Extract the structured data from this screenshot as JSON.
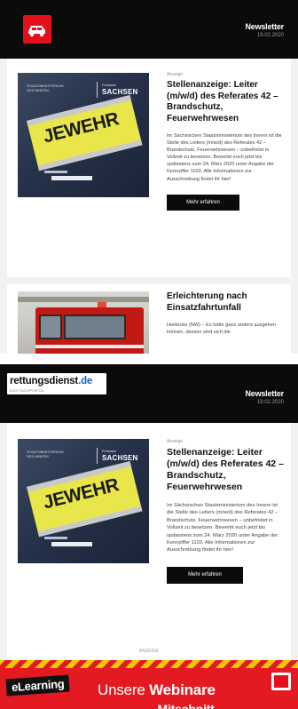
{
  "colors": {
    "header_bg": "#0b0b0b",
    "brand_red": "#e3101b",
    "button_bg": "#0b0b0b",
    "banner_red": "#e31a22",
    "link_blue": "#1f5fb0"
  },
  "view1": {
    "header": {
      "logo_icon": "red-car-logo-icon",
      "title": "Newsletter",
      "date": "19.02.2020"
    },
    "article1": {
      "kicker": "Anzeige",
      "title": "Stellenanzeige: Leiter (m/w/d) des Referates 42 – Brandschutz, Feuerwehrwesen",
      "image": {
        "patch_text": "JEWEHR",
        "logo_small": "Freistaat",
        "logo_large": "SACHSEN",
        "dept_line1": "STAATSMINISTERIUM",
        "dept_line2": "DES INNERN"
      },
      "body": "Im Sächsischen Staatsministerium des Innern ist die Stelle des Leiters (m/w/d) des Referates 42 – Brandschutz, Feuerwehrwesen – unbefristet in Vollzeit zu besetzen. Bewerbt euch jetzt bis spätestens zum 24. März 2020 unter Angabe der Kennziffer 1103. Alle Informationen zur Ausschreibung findet ihr hier!",
      "button_label": "Mehr erfahren"
    },
    "article2": {
      "title": "Erleichterung nach Einsatzfahrtunfall",
      "body": "Heidecke (NW) – Es hätte ganz anders ausgehen können, dessen sind sich die"
    }
  },
  "view2": {
    "header": {
      "logo_text": "rettungsdienst",
      "logo_tld": ".de",
      "logo_tagline": "DAS FACHPORTAL",
      "title": "Newsletter",
      "date": "19.02.2020"
    },
    "article1": {
      "kicker": "Anzeige",
      "title": "Stellenanzeige: Leiter (m/w/d) des Referates 42 – Brandschutz, Feuerwehrwesen",
      "image": {
        "patch_text": "JEWEHR",
        "logo_small": "Freistaat",
        "logo_large": "SACHSEN",
        "dept_line1": "STAATSMINISTERIUM",
        "dept_line2": "DES INNERN"
      },
      "body": "Im Sächsischen Staatsministerium des Innern ist die Stelle des Leiters (m/w/d) des Referates 42 – Brandschutz, Feuerwehrwesen – unbefristet in Vollzeit zu besetzen. Bewerbt euch jetzt bis spätestens zum 24. März 2020 unter Angabe der Kennziffer 1103. Alle Informationen zur Ausschreibung findet ihr hier!",
      "button_label": "Mehr erfahren"
    },
    "footer": {
      "ad_label": "ANZEIGE",
      "banner_tag": "eLearning",
      "banner_head_pre": "Unsere ",
      "banner_head_bold": "Webinare",
      "banner_sub": "… Mitschnitt …"
    }
  }
}
